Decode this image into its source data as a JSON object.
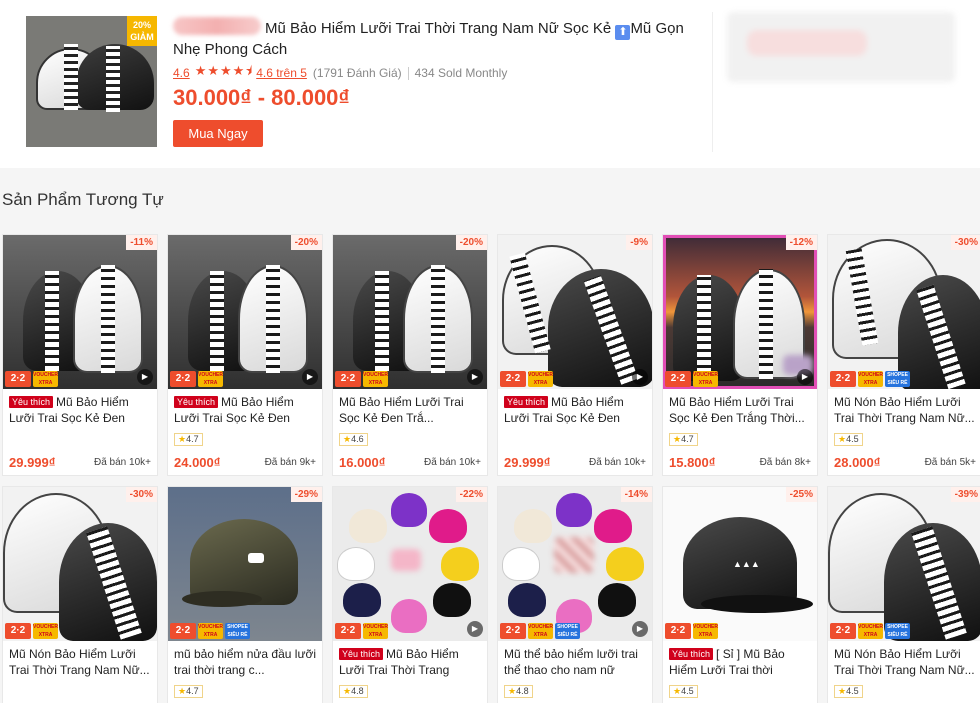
{
  "top_product": {
    "title": "Mũ Bảo Hiểm Lưỡi Trai Thời Trang Nam Nữ Sọc Kẻ",
    "title_after_icon": "Mũ Gọn Nhẹ Phong Cách",
    "up_icon": "⬆",
    "discount_tag_pct": "20%",
    "discount_tag_word": "GIẢM",
    "rating_value": "4.6",
    "stars": "★★★★⯨",
    "rating_link": "4.6 trên 5",
    "review_count": "(1791 Đánh Giá)",
    "sold": "434 Sold Monthly",
    "price_range": "30.000₫ - 80.000₫",
    "buy_label": "Mua Ngay"
  },
  "section_title": "Sản Phẩm Tương Tự",
  "badge_22": "2·2",
  "badge_voucher": "VOUCHER XTRA",
  "badge_shopee": "SHOPEE SIÊU RẺ",
  "fav_label": "Yêu thích",
  "play_icon": "▶",
  "star_icon": "★",
  "products": [
    {
      "discount": "-11%",
      "fav": true,
      "name": "Mũ Bảo Hiểm Lưỡi Trai Sọc Kẻ Đen Trắ...",
      "rating": "",
      "price": "29.999₫",
      "sold": "Đã bán 10k+"
    },
    {
      "discount": "-20%",
      "fav": true,
      "name": "Mũ Bảo Hiểm Lưỡi Trai Sọc Kẻ Đen Trắ...",
      "rating": "4.7",
      "price": "24.000₫",
      "sold": "Đã bán 9k+"
    },
    {
      "discount": "-20%",
      "fav": false,
      "name": "Mũ Bảo Hiểm Lưỡi Trai Sọc Kẻ Đen Trắ...",
      "rating": "4.6",
      "price": "16.000₫",
      "sold": "Đã bán 10k+"
    },
    {
      "discount": "-9%",
      "fav": true,
      "name": "Mũ Bảo Hiểm Lưỡi Trai Sọc Kẻ Đen Trắ...",
      "rating": "",
      "price": "29.999₫",
      "sold": "Đã bán 10k+"
    },
    {
      "discount": "-12%",
      "fav": false,
      "name": "Mũ Bảo Hiểm Lưỡi Trai Sọc Kẻ Đen Trắng Thời...",
      "rating": "4.7",
      "price": "15.800₫",
      "sold": "Đã bán 8k+"
    },
    {
      "discount": "-30%",
      "fav": false,
      "name": "Mũ Nón Bảo Hiểm Lưỡi Trai Thời Trang Nam Nữ...",
      "rating": "4.5",
      "price": "28.000₫",
      "sold": "Đã bán 5k+"
    },
    {
      "discount": "-30%",
      "fav": false,
      "name": "Mũ Nón Bảo Hiểm Lưỡi Trai Thời Trang Nam Nữ...",
      "rating": "",
      "price": "",
      "sold": ""
    },
    {
      "discount": "-29%",
      "fav": false,
      "name": "mũ bảo hiểm nửa đầu lưỡi trai thời trang c...",
      "rating": "4.7",
      "price": "",
      "sold": ""
    },
    {
      "discount": "-22%",
      "fav": true,
      "name": "Mũ Bảo Hiểm Lưỡi Trai Thời Trang Cho...",
      "rating": "4.8",
      "price": "",
      "sold": ""
    },
    {
      "discount": "-14%",
      "fav": false,
      "name": "Mũ thể bảo hiểm lưỡi trai thể thao cho nam nữ",
      "rating": "4.8",
      "price": "",
      "sold": ""
    },
    {
      "discount": "-25%",
      "fav": true,
      "name": "[ Sỉ ] Mũ Bảo Hiểm Lưỡi Trai thời trang...",
      "rating": "4.5",
      "price": "",
      "sold": ""
    },
    {
      "discount": "-39%",
      "fav": false,
      "name": "Mũ Nón Bảo Hiểm Lưỡi Trai Thời Trang Nam Nữ...",
      "rating": "4.5",
      "price": "",
      "sold": ""
    }
  ],
  "colors": {
    "accent": "#ee4d2d",
    "fav": "#d0011b",
    "voucher": "#f6b800",
    "shopee_blue": "#2673dd"
  }
}
